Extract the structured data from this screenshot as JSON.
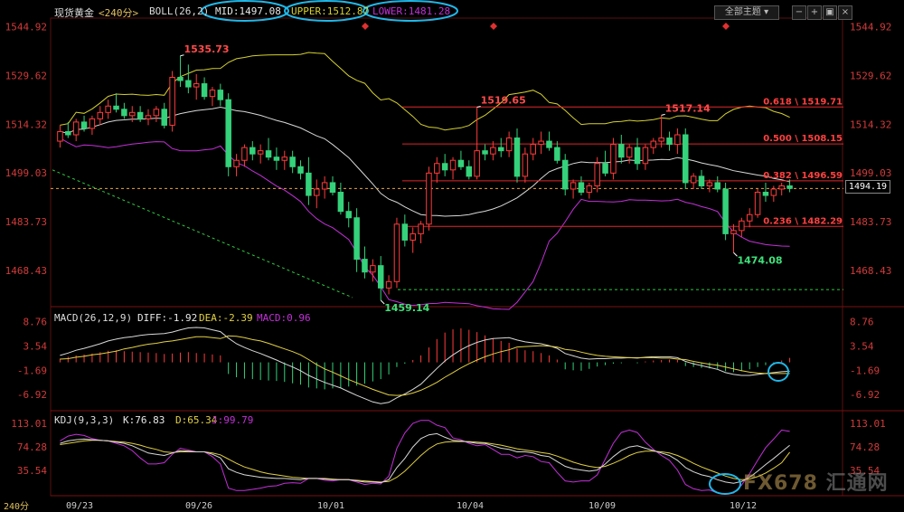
{
  "header": {
    "title": "现货黄金",
    "period": "<240分>",
    "boll_name": "BOLL(26,2)",
    "mid": "MID:1497.08",
    "upper": "UPPER:1512.87",
    "lower": "LOWER:1481.28",
    "theme_button": "全部主题",
    "macd_label": "MACD(26,12,9)",
    "diff": "DIFF:-1.92",
    "dea": "DEA:-2.39",
    "macd_val": "MACD:0.96",
    "kdj_label": "KDJ(9,3,3)",
    "k": "K:76.83",
    "d": "D:65.34",
    "j": "J:99.79",
    "period_footer": "240分"
  },
  "colors": {
    "up": "#ff3b3b",
    "down": "#34d27a",
    "mid": "#d8d8d8",
    "upper": "#d6d12e",
    "lower": "#c42fd9",
    "fib": "#e0262a",
    "cyan": "#1fb8e8",
    "dea": "#e2d042"
  },
  "current_price": "1494.19",
  "watermark": {
    "brand": "FX678",
    "suffix": "汇通网"
  },
  "chart_data": [
    {
      "type": "candlestick",
      "panel": "price",
      "x_labels": [
        "09/23",
        "09/26",
        "10/01",
        "10/04",
        "10/09",
        "10/12"
      ],
      "y_ticks": [
        "1544.92",
        "1529.62",
        "1514.32",
        "1499.03",
        "1483.73",
        "1468.43"
      ],
      "ylim": [
        1458,
        1547
      ],
      "ohlc": [
        [
          1509,
          1514,
          1507,
          1512
        ],
        [
          1512,
          1515,
          1510,
          1511
        ],
        [
          1511,
          1516,
          1509,
          1515
        ],
        [
          1515,
          1517,
          1512,
          1513
        ],
        [
          1513,
          1517,
          1511,
          1516
        ],
        [
          1516,
          1520,
          1514,
          1518
        ],
        [
          1518,
          1522,
          1516,
          1520
        ],
        [
          1520,
          1524,
          1518,
          1519
        ],
        [
          1519,
          1521,
          1516,
          1517
        ],
        [
          1517,
          1520,
          1515,
          1518
        ],
        [
          1518,
          1520,
          1515,
          1516
        ],
        [
          1516,
          1519,
          1514,
          1517
        ],
        [
          1517,
          1520,
          1515,
          1519
        ],
        [
          1519,
          1521,
          1513,
          1514
        ],
        [
          1514,
          1531,
          1512,
          1529
        ],
        [
          1529,
          1535.73,
          1526,
          1528
        ],
        [
          1528,
          1533,
          1524,
          1526
        ],
        [
          1526,
          1530,
          1522,
          1527
        ],
        [
          1527,
          1529,
          1522,
          1523
        ],
        [
          1523,
          1526,
          1520,
          1525
        ],
        [
          1525,
          1527,
          1520,
          1522
        ],
        [
          1522,
          1524,
          1498,
          1501
        ],
        [
          1501,
          1505,
          1498,
          1503
        ],
        [
          1503,
          1508,
          1501,
          1507
        ],
        [
          1507,
          1509,
          1503,
          1505
        ],
        [
          1505,
          1508,
          1502,
          1506
        ],
        [
          1506,
          1510,
          1503,
          1504
        ],
        [
          1504,
          1507,
          1500,
          1503
        ],
        [
          1503,
          1506,
          1500,
          1504
        ],
        [
          1504,
          1506,
          1499,
          1501
        ],
        [
          1501,
          1503,
          1497,
          1499
        ],
        [
          1499,
          1504,
          1489,
          1492
        ],
        [
          1492,
          1497,
          1488,
          1494
        ],
        [
          1494,
          1498,
          1491,
          1496
        ],
        [
          1496,
          1498,
          1492,
          1493
        ],
        [
          1493,
          1496,
          1486,
          1487
        ],
        [
          1487,
          1490,
          1482,
          1485
        ],
        [
          1485,
          1488,
          1468,
          1472
        ],
        [
          1472,
          1476,
          1466,
          1468
        ],
        [
          1468,
          1472,
          1465,
          1470
        ],
        [
          1470,
          1473,
          1459.14,
          1463
        ],
        [
          1463,
          1467,
          1461,
          1465
        ],
        [
          1465,
          1485,
          1463,
          1483
        ],
        [
          1483,
          1486,
          1476,
          1478
        ],
        [
          1478,
          1482,
          1474,
          1480
        ],
        [
          1480,
          1484,
          1477,
          1483
        ],
        [
          1483,
          1501,
          1481,
          1499
        ],
        [
          1499,
          1504,
          1496,
          1502
        ],
        [
          1502,
          1505,
          1498,
          1500
        ],
        [
          1500,
          1504,
          1497,
          1503
        ],
        [
          1503,
          1506,
          1500,
          1501
        ],
        [
          1501,
          1503,
          1497,
          1498
        ],
        [
          1498,
          1519.65,
          1497,
          1506
        ],
        [
          1506,
          1508,
          1503,
          1505
        ],
        [
          1505,
          1509,
          1503,
          1507
        ],
        [
          1507,
          1510,
          1504,
          1506
        ],
        [
          1506,
          1512,
          1504,
          1510
        ],
        [
          1510,
          1513,
          1496,
          1498
        ],
        [
          1498,
          1507,
          1496,
          1505
        ],
        [
          1505,
          1510,
          1503,
          1508
        ],
        [
          1508,
          1512,
          1505,
          1509
        ],
        [
          1509,
          1512,
          1506,
          1507
        ],
        [
          1507,
          1509,
          1502,
          1503
        ],
        [
          1503,
          1505,
          1492,
          1494
        ],
        [
          1494,
          1497,
          1491,
          1496
        ],
        [
          1496,
          1498,
          1492,
          1493
        ],
        [
          1493,
          1496,
          1491,
          1495
        ],
        [
          1495,
          1504,
          1493,
          1502
        ],
        [
          1502,
          1506,
          1498,
          1499
        ],
        [
          1499,
          1510,
          1497,
          1508
        ],
        [
          1508,
          1511,
          1502,
          1504
        ],
        [
          1504,
          1508,
          1502,
          1507
        ],
        [
          1507,
          1510,
          1500,
          1502
        ],
        [
          1502,
          1508,
          1500,
          1507
        ],
        [
          1507,
          1510,
          1505,
          1509
        ],
        [
          1509,
          1517.14,
          1507,
          1510
        ],
        [
          1510,
          1512,
          1506,
          1508
        ],
        [
          1508,
          1513,
          1505,
          1511
        ],
        [
          1511,
          1513,
          1494,
          1496
        ],
        [
          1496,
          1499,
          1494,
          1498
        ],
        [
          1498,
          1500,
          1494,
          1495
        ],
        [
          1495,
          1497,
          1493,
          1496
        ],
        [
          1496,
          1498,
          1493,
          1494
        ],
        [
          1494,
          1496,
          1478,
          1480
        ],
        [
          1480,
          1483,
          1474.08,
          1481
        ],
        [
          1481,
          1485,
          1479,
          1484
        ],
        [
          1484,
          1488,
          1482,
          1486
        ],
        [
          1486,
          1494,
          1485,
          1493
        ],
        [
          1493,
          1496,
          1490,
          1492
        ],
        [
          1492,
          1495,
          1490,
          1494
        ],
        [
          1494,
          1496,
          1492,
          1495
        ],
        [
          1495,
          1497,
          1493,
          1494.19
        ]
      ],
      "annotations": [
        {
          "label": "1535.73",
          "value": 1535.73,
          "bar": 15
        },
        {
          "label": "1459.14",
          "value": 1459.14,
          "bar": 40
        },
        {
          "label": "1519.65",
          "value": 1519.65,
          "bar": 52
        },
        {
          "label": "1517.14",
          "value": 1517.14,
          "bar": 75
        },
        {
          "label": "1474.08",
          "value": 1474.08,
          "bar": 84
        }
      ],
      "fib_levels": [
        {
          "label": "0.618 \\ 1519.71",
          "value": 1519.71
        },
        {
          "label": "0.500 \\ 1508.15",
          "value": 1508.15
        },
        {
          "label": "0.382 \\ 1496.59",
          "value": 1496.59
        },
        {
          "label": "0.236 \\ 1482.29",
          "value": 1482.29
        }
      ],
      "reference_lines": [
        {
          "value": 1494.19,
          "style": "dashed",
          "color": "#e6a545"
        },
        {
          "value": 1462.5,
          "style": "dashed",
          "color": "#2ecc40"
        }
      ]
    },
    {
      "type": "histogram+line",
      "panel": "macd",
      "y_ticks": [
        "8.76",
        "3.54",
        "-1.69",
        "-6.92"
      ],
      "ylim": [
        -10,
        11
      ],
      "hist": [
        0.8,
        1.2,
        1.5,
        1.7,
        1.9,
        2.2,
        2.5,
        2.6,
        2.4,
        2.3,
        2.2,
        2.1,
        2.0,
        1.8,
        1.9,
        2.1,
        2.2,
        2.0,
        1.9,
        1.7,
        1.5,
        -2.5,
        -3.2,
        -3.5,
        -3.6,
        -3.8,
        -3.9,
        -4.0,
        -4.2,
        -4.5,
        -4.8,
        -5.4,
        -5.6,
        -5.8,
        -5.6,
        -5.5,
        -5.2,
        -5.0,
        -4.6,
        -4.1,
        -3.6,
        -2.6,
        -1.0,
        -0.3,
        0.5,
        1.5,
        3.2,
        5.0,
        6.4,
        7.1,
        7.3,
        7.0,
        6.5,
        5.8,
        5.2,
        4.6,
        4.2,
        3.0,
        2.6,
        2.4,
        2.0,
        1.5,
        0.6,
        -1.5,
        -1.7,
        -1.8,
        -1.4,
        -0.9,
        -0.6,
        -0.3,
        -0.2,
        0.0,
        -0.2,
        0.2,
        0.4,
        0.5,
        0.6,
        0.5,
        -0.8,
        -1.0,
        -1.2,
        -1.3,
        -1.4,
        -1.9,
        -2.1,
        -1.9,
        -1.5,
        -1.0,
        -0.6,
        -0.2,
        0.4,
        0.96
      ],
      "diff": [
        1.5,
        2.0,
        2.6,
        3.0,
        3.5,
        4.0,
        4.6,
        5.0,
        5.3,
        5.5,
        5.8,
        6.0,
        6.1,
        6.2,
        6.5,
        7.0,
        7.4,
        7.5,
        7.4,
        7.0,
        6.6,
        5.2,
        4.0,
        3.2,
        2.5,
        1.9,
        1.2,
        0.5,
        -0.3,
        -1.0,
        -1.8,
        -2.8,
        -3.6,
        -4.3,
        -4.9,
        -5.5,
        -6.3,
        -7.1,
        -7.8,
        -8.5,
        -8.9,
        -8.6,
        -7.6,
        -6.8,
        -5.8,
        -4.7,
        -3.0,
        -1.3,
        0.3,
        1.6,
        2.7,
        3.6,
        4.3,
        4.8,
        5.1,
        5.2,
        5.3,
        4.8,
        4.4,
        4.2,
        4.0,
        3.6,
        3.0,
        1.9,
        1.4,
        0.9,
        0.7,
        0.8,
        0.8,
        0.9,
        0.9,
        1.0,
        0.9,
        1.1,
        1.2,
        1.2,
        1.2,
        1.0,
        0.2,
        -0.3,
        -0.7,
        -1.1,
        -1.5,
        -2.2,
        -2.6,
        -2.8,
        -2.8,
        -2.6,
        -2.4,
        -2.2,
        -2.0,
        -1.92
      ],
      "dea": [
        0.7,
        0.8,
        1.1,
        1.3,
        1.6,
        1.8,
        2.1,
        2.4,
        2.9,
        3.2,
        3.6,
        3.9,
        4.1,
        4.4,
        4.6,
        4.9,
        5.2,
        5.5,
        5.5,
        5.3,
        5.1,
        5.7,
        5.6,
        5.3,
        4.9,
        4.6,
        4.1,
        3.5,
        2.9,
        2.3,
        1.6,
        0.6,
        -0.5,
        -1.4,
        -2.1,
        -2.9,
        -3.7,
        -4.4,
        -5.1,
        -5.8,
        -6.4,
        -7.0,
        -7.1,
        -7.0,
        -6.6,
        -6.0,
        -5.2,
        -4.3,
        -3.2,
        -2.2,
        -1.2,
        -0.3,
        0.5,
        1.2,
        1.8,
        2.3,
        2.7,
        3.3,
        3.4,
        3.5,
        3.6,
        3.5,
        3.3,
        2.8,
        2.6,
        2.2,
        1.8,
        1.5,
        1.3,
        1.2,
        1.1,
        1.0,
        1.0,
        1.0,
        1.0,
        0.9,
        0.9,
        0.7,
        0.6,
        0.2,
        -0.1,
        -0.4,
        -0.6,
        -1.0,
        -1.4,
        -1.8,
        -2.1,
        -2.3,
        -2.4,
        -2.4,
        -2.4,
        -2.39
      ]
    },
    {
      "type": "line",
      "panel": "kdj",
      "y_ticks": [
        "113.01",
        "74.28",
        "35.54"
      ],
      "ylim": [
        -5,
        125
      ],
      "k": [
        80,
        84,
        86,
        87,
        86,
        85,
        84,
        82,
        80,
        76,
        70,
        64,
        62,
        60,
        64,
        68,
        67,
        66,
        66,
        62,
        56,
        38,
        32,
        28,
        26,
        24,
        23,
        22,
        22,
        21,
        20,
        22,
        22,
        21,
        20,
        20,
        20,
        18,
        16,
        16,
        15,
        20,
        40,
        55,
        74,
        88,
        94,
        96,
        90,
        85,
        84,
        82,
        80,
        80,
        76,
        72,
        70,
        66,
        66,
        64,
        60,
        58,
        50,
        42,
        38,
        36,
        34,
        36,
        46,
        58,
        68,
        74,
        76,
        72,
        68,
        64,
        60,
        52,
        40,
        33,
        28,
        25,
        20,
        16,
        14,
        17,
        24,
        34,
        45,
        55,
        66,
        76.83
      ],
      "d": [
        78,
        80,
        82,
        84,
        85,
        85,
        84,
        83,
        82,
        80,
        77,
        73,
        70,
        66,
        65,
        66,
        66,
        66,
        66,
        64,
        61,
        54,
        47,
        41,
        37,
        33,
        30,
        28,
        26,
        24,
        23,
        22,
        22,
        22,
        21,
        20,
        20,
        19,
        18,
        17,
        16,
        17,
        24,
        34,
        47,
        60,
        71,
        79,
        82,
        83,
        83,
        83,
        82,
        81,
        79,
        77,
        74,
        71,
        69,
        67,
        65,
        63,
        59,
        54,
        49,
        45,
        42,
        40,
        42,
        47,
        53,
        60,
        65,
        67,
        67,
        66,
        64,
        60,
        54,
        47,
        41,
        36,
        31,
        26,
        22,
        20,
        21,
        25,
        31,
        39,
        48,
        65.34
      ],
      "j": [
        84,
        92,
        95,
        93,
        88,
        85,
        84,
        80,
        76,
        68,
        56,
        46,
        46,
        48,
        62,
        72,
        69,
        66,
        66,
        58,
        46,
        6,
        2,
        2,
        4,
        6,
        9,
        10,
        14,
        15,
        14,
        22,
        22,
        19,
        18,
        20,
        20,
        16,
        12,
        14,
        13,
        26,
        72,
        97,
        113,
        118,
        118,
        110,
        106,
        89,
        86,
        80,
        76,
        78,
        70,
        62,
        62,
        56,
        60,
        58,
        50,
        48,
        32,
        18,
        16,
        18,
        18,
        28,
        54,
        80,
        98,
        102,
        98,
        82,
        70,
        60,
        52,
        36,
        12,
        5,
        2,
        3,
        -2,
        -4,
        -2,
        11,
        30,
        52,
        73,
        87,
        102,
        99.79
      ]
    }
  ]
}
